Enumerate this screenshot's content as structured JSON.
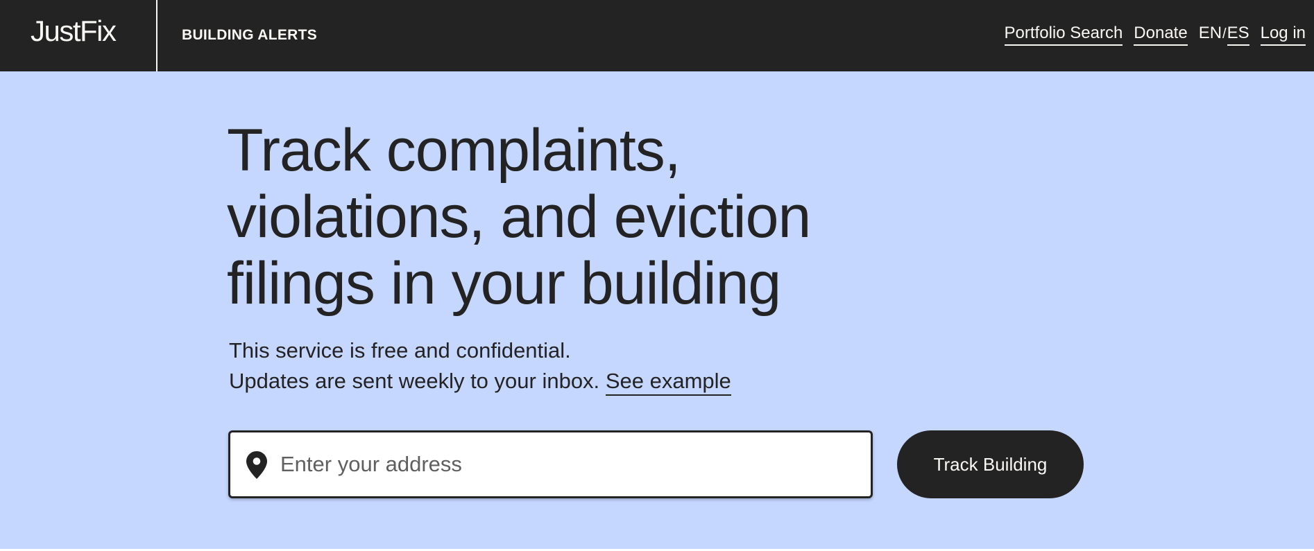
{
  "header": {
    "logo": "JustFix",
    "product": "BUILDING ALERTS",
    "nav": {
      "portfolio_search": "Portfolio Search",
      "donate": "Donate",
      "lang_en": "EN",
      "lang_separator": "/",
      "lang_es": "ES",
      "login": "Log in"
    }
  },
  "hero": {
    "headline": "Track complaints, violations, and eviction filings in your building",
    "subtext_line1": "This service is free and confidential.",
    "subtext_line2": "Updates are sent weekly to your inbox.",
    "see_example": "See example",
    "address_placeholder": "Enter your address",
    "address_value": "",
    "track_button": "Track Building",
    "address_icon": "map-pin-icon"
  },
  "colors": {
    "header_bg": "#242323",
    "hero_bg": "#c5d6ff",
    "text_dark": "#242323",
    "text_light": "#faf8f4"
  }
}
